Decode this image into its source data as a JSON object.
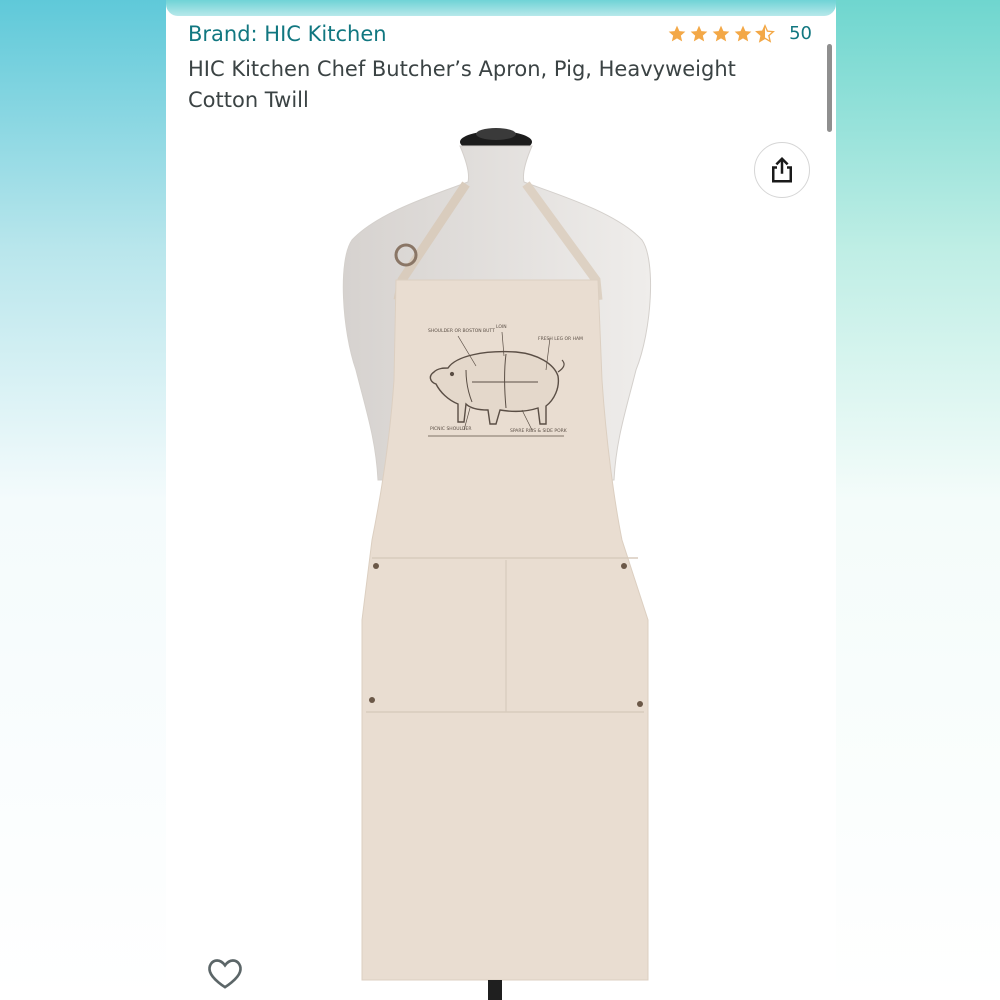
{
  "product": {
    "brand": "Brand: HIC Kitchen",
    "title": "HIC Kitchen Chef Butcher’s Apron, Pig, Heavyweight Cotton Twill",
    "rating": {
      "value": 4.5,
      "max": 5,
      "count": "50",
      "star_color": "#f3a847"
    },
    "image": {
      "diagram_labels": [
        "SHOULDER OR BOSTON BUTT",
        "LOIN",
        "FRESH LEG OR HAM",
        "PICNIC SHOULDER",
        "SPARE RIBS & SIDE PORK"
      ]
    }
  },
  "icons": {
    "share": "share-icon",
    "wishlist": "heart-outline-icon",
    "rating": "star-icon"
  },
  "colors": {
    "link": "#117780",
    "title": "#3b4344",
    "apron": "#e9ddd1",
    "star": "#f3a847"
  }
}
